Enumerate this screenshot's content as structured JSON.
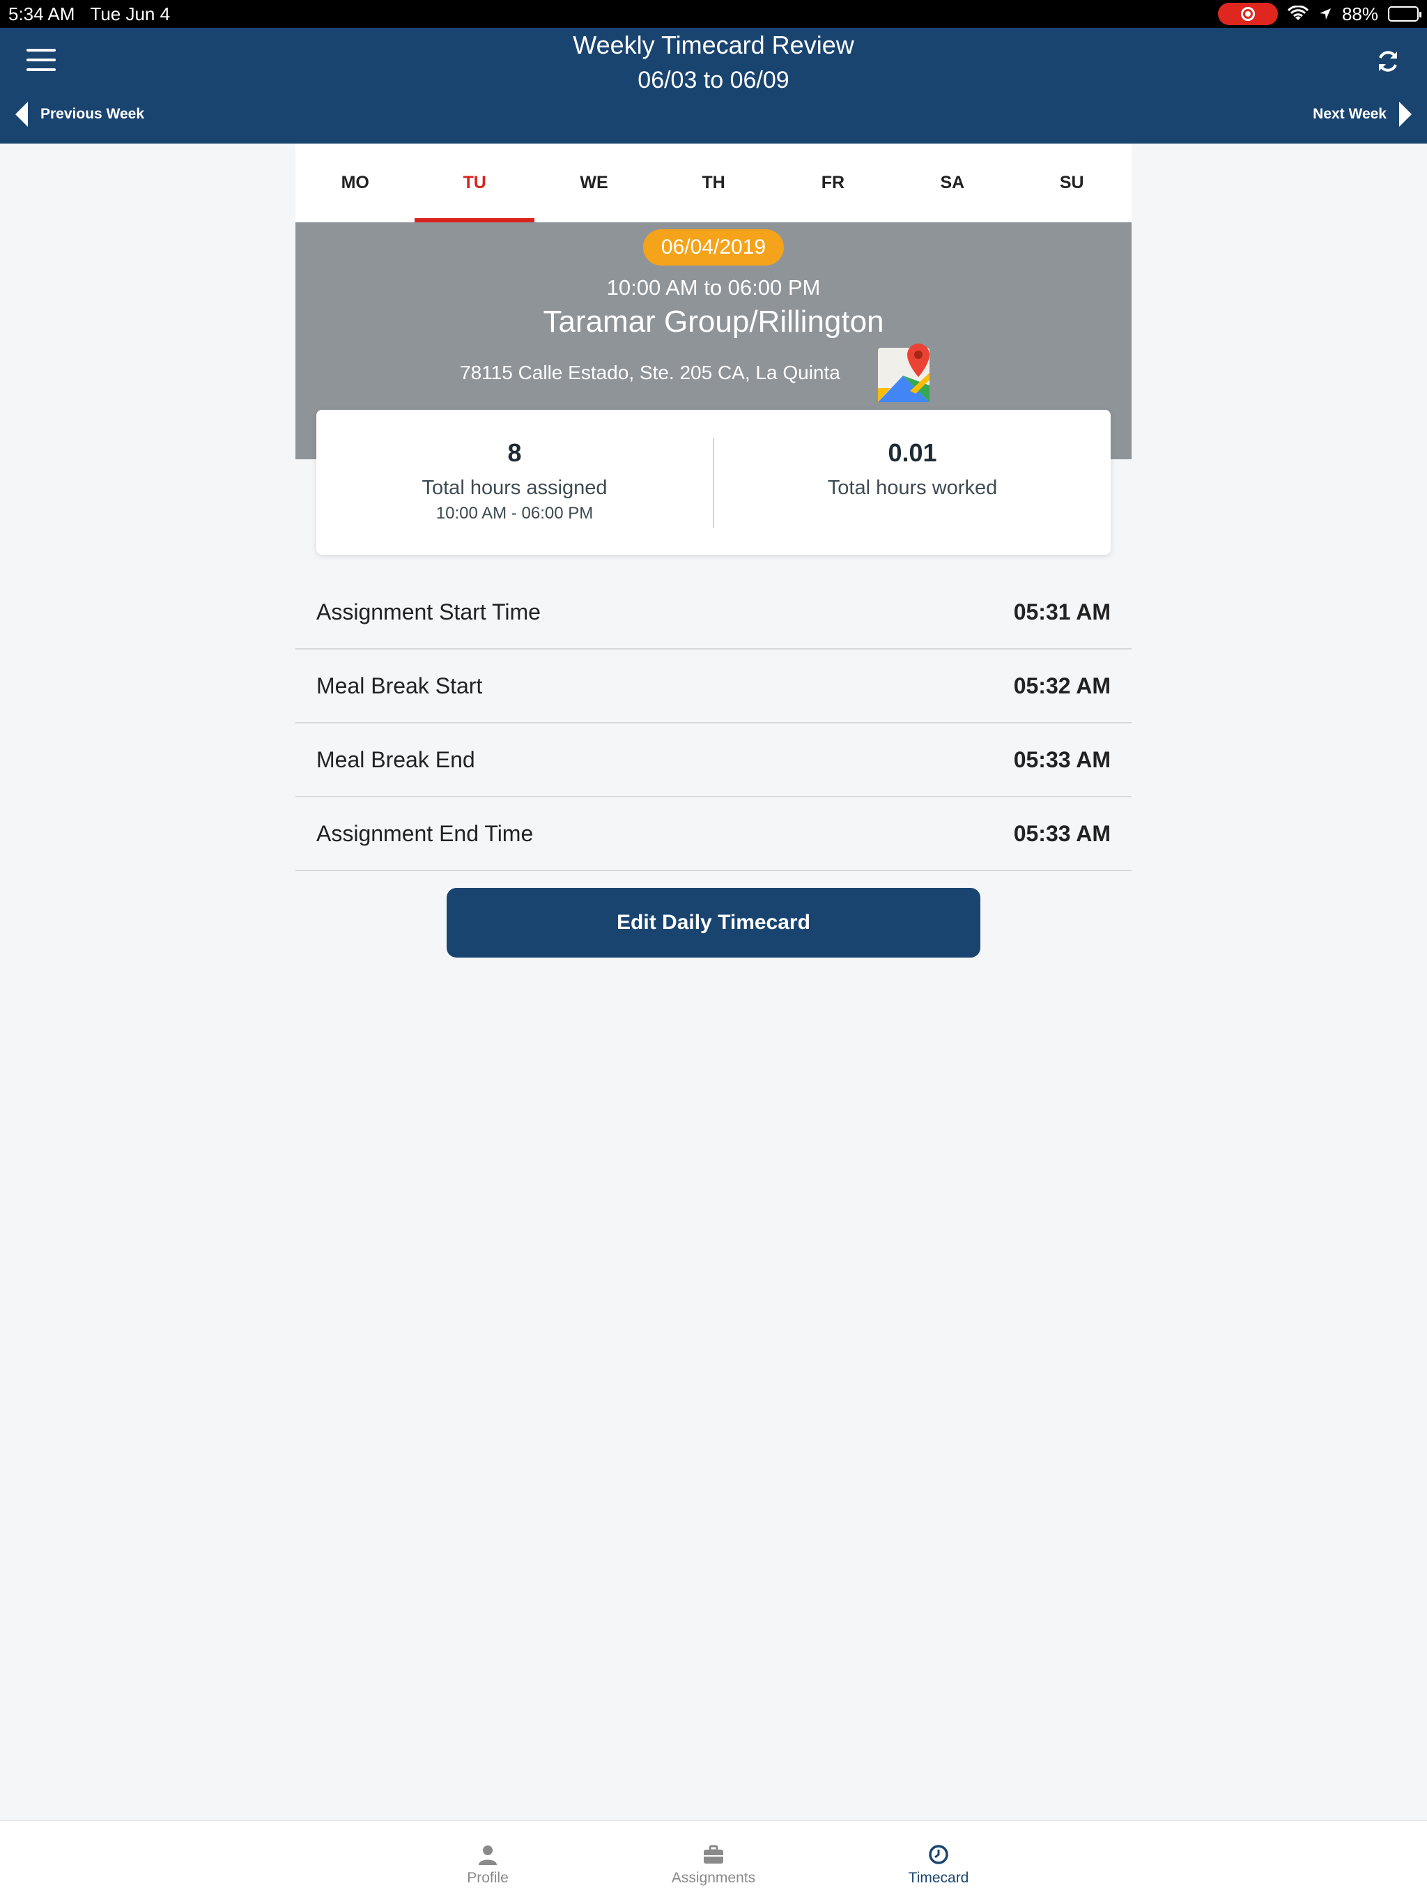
{
  "status_bar": {
    "time": "5:34 AM",
    "date": "Tue Jun 4",
    "battery": "88%",
    "battery_level": 0.88
  },
  "header": {
    "title": "Weekly Timecard Review",
    "range": "06/03 to 06/09",
    "prev_week": "Previous Week",
    "next_week": "Next Week"
  },
  "days": [
    "MO",
    "TU",
    "WE",
    "TH",
    "FR",
    "SA",
    "SU"
  ],
  "active_day": "TU",
  "assignment": {
    "date": "06/04/2019",
    "shift": "10:00 AM to 06:00 PM",
    "client": "Taramar Group/Rillington",
    "address": "78115 Calle Estado, Ste. 205 CA, La Quinta"
  },
  "hours": {
    "assigned_value": "8",
    "assigned_label": "Total hours assigned",
    "assigned_range": "10:00 AM - 06:00 PM",
    "worked_value": "0.01",
    "worked_label": "Total hours worked"
  },
  "time_entries": [
    {
      "label": "Assignment Start Time",
      "value": "05:31 AM"
    },
    {
      "label": "Meal Break Start",
      "value": "05:32 AM"
    },
    {
      "label": "Meal Break End",
      "value": "05:33 AM"
    },
    {
      "label": "Assignment End Time",
      "value": "05:33 AM"
    }
  ],
  "edit_button": "Edit Daily Timecard",
  "tabs": [
    {
      "label": "Profile",
      "icon": "person-icon"
    },
    {
      "label": "Assignments",
      "icon": "briefcase-icon"
    },
    {
      "label": "Timecard",
      "icon": "clock-icon"
    }
  ],
  "active_tab": "Timecard",
  "colors": {
    "header": "#1a4470",
    "accent_red": "#d9231c",
    "date_pill": "#f5a31a",
    "band": "#8f9498"
  }
}
